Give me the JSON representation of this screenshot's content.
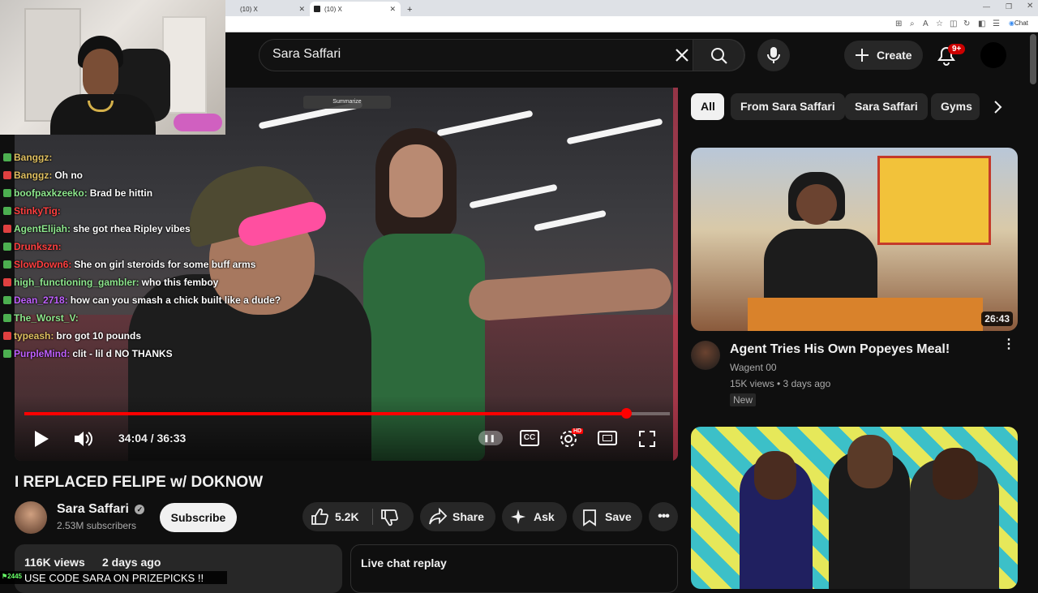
{
  "browser": {
    "tabs": [
      {
        "label": "(10) X"
      },
      {
        "label": "(10) X"
      }
    ],
    "new_tab_label": "+",
    "chat_label": "Chat"
  },
  "header": {
    "search_value": "Sara Saffari",
    "create_label": "Create",
    "notification_badge": "9+"
  },
  "video": {
    "summarize_label": "Summarize",
    "time_label": "34:04 / 36:33",
    "progress": 0.932,
    "title": "I REPLACED FELIPE w/ DOKNOW"
  },
  "chat_overlay": {
    "messages": [
      {
        "user": "Banggz:",
        "text": "",
        "color": "#e0c060"
      },
      {
        "user": "Banggz:",
        "text": "Oh no",
        "color": "#e0c060"
      },
      {
        "user": "boofpaxkzeeko:",
        "text": "Brad be hittin",
        "color": "#8ee88e"
      },
      {
        "user": "StinkyTig:",
        "text": "",
        "color": "#ff4040"
      },
      {
        "user": "AgentElijah:",
        "text": "she got rhea Ripley vibes",
        "color": "#8ee88e"
      },
      {
        "user": "Drunkszn:",
        "text": "",
        "color": "#ff4040"
      },
      {
        "user": "SlowDown6:",
        "text": "She on girl steroids for some buff arms",
        "color": "#ff4040"
      },
      {
        "user": "high_functioning_gambler:",
        "text": "who this femboy",
        "color": "#8ee88e"
      },
      {
        "user": "Dean_2718:",
        "text": "how can you smash a chick built like a dude?",
        "color": "#c060ff"
      },
      {
        "user": "The_Worst_V:",
        "text": "",
        "color": "#8ee88e"
      },
      {
        "user": "typeash:",
        "text": "bro got 10 pounds",
        "color": "#e0c060"
      },
      {
        "user": "PurpleMind:",
        "text": "clit - lil d NO THANKS",
        "color": "#c060ff"
      }
    ],
    "bottom_count": "2445",
    "bottom_text": "USE CODE SARA ON PRIZEPICKS !!"
  },
  "channel": {
    "name": "Sara Saffari",
    "subscribers": "2.53M subscribers",
    "subscribe_label": "Subscribe"
  },
  "actions": {
    "likes": "5.2K",
    "share": "Share",
    "ask": "Ask",
    "save": "Save"
  },
  "description": {
    "views": "116K views",
    "date": "2 days ago"
  },
  "live_chat": {
    "label": "Live chat replay"
  },
  "chips": [
    "All",
    "From Sara Saffari",
    "Sara Saffari",
    "Gyms"
  ],
  "recommendations": [
    {
      "title": "Agent Tries His Own Popeyes Meal!",
      "channel": "Wagent 00",
      "meta": "15K views • 3 days ago",
      "badge": "New",
      "duration": "26:43"
    }
  ],
  "colors": {
    "accent": "#ff0000",
    "background": "#0f0f0f",
    "chip_active": "#f1f1f1"
  }
}
